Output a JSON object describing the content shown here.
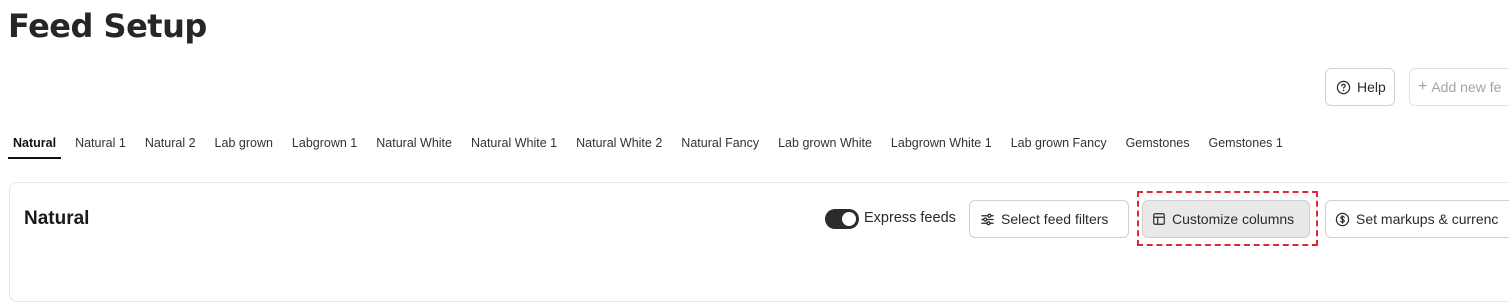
{
  "page": {
    "title": "Feed Setup"
  },
  "header_actions": {
    "help_label": "Help",
    "add_feed_label": "Add new fe"
  },
  "tabs": [
    {
      "label": "Natural",
      "active": true
    },
    {
      "label": "Natural 1",
      "active": false
    },
    {
      "label": "Natural 2",
      "active": false
    },
    {
      "label": "Lab grown",
      "active": false
    },
    {
      "label": "Labgrown 1",
      "active": false
    },
    {
      "label": "Natural White",
      "active": false
    },
    {
      "label": "Natural White 1",
      "active": false
    },
    {
      "label": "Natural White 2",
      "active": false
    },
    {
      "label": "Natural Fancy",
      "active": false
    },
    {
      "label": "Lab grown White",
      "active": false
    },
    {
      "label": "Labgrown White 1",
      "active": false
    },
    {
      "label": "Lab grown Fancy",
      "active": false
    },
    {
      "label": "Gemstones",
      "active": false
    },
    {
      "label": "Gemstones 1",
      "active": false
    }
  ],
  "panel": {
    "title": "Natural",
    "express_feeds": {
      "label": "Express feeds",
      "enabled": true
    },
    "select_filters_label": "Select feed filters",
    "customize_columns_label": "Customize columns",
    "set_markups_label": "Set markups & currenc"
  },
  "colors": {
    "highlight": "#d9293a",
    "toggle_on": "#2b2b2b",
    "active_tab_underline": "#111111"
  }
}
